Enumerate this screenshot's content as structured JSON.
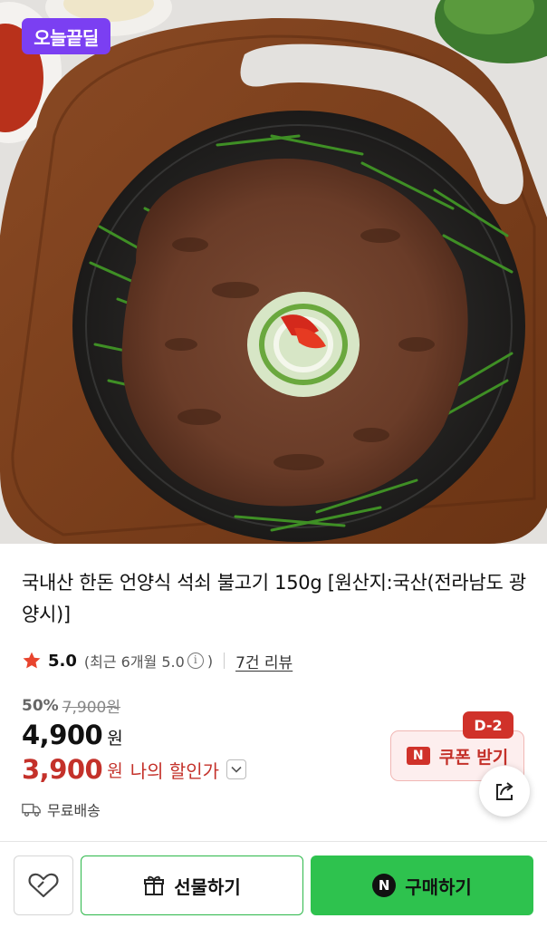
{
  "hero": {
    "badge_label": "오늘끝딜"
  },
  "product": {
    "title": "국내산 한돈 언양식 석쇠 불고기 150g [원산지:국산(전라남도 광양시)]",
    "rating": {
      "score": "5.0",
      "recent_prefix": "(최근 6개월 5.0",
      "recent_suffix": ")",
      "review_link": "7건 리뷰"
    },
    "discount_rate": "50%",
    "original_price": "7,900원",
    "price": "4,900",
    "price_unit": "원",
    "my_price": "3,900",
    "my_price_unit": "원",
    "my_price_label": "나의 할인가",
    "shipping": "무료배송"
  },
  "coupon": {
    "dday": "D-2",
    "n_mark": "N",
    "label": "쿠폰 받기"
  },
  "bottom_bar": {
    "gift_label": "선물하기",
    "buy_mark": "N",
    "buy_label": "구매하기"
  },
  "colors": {
    "deal_purple": "#7b3ff2",
    "sale_red": "#c4312a",
    "buy_green": "#2ec24e",
    "star": "#e8442e"
  }
}
